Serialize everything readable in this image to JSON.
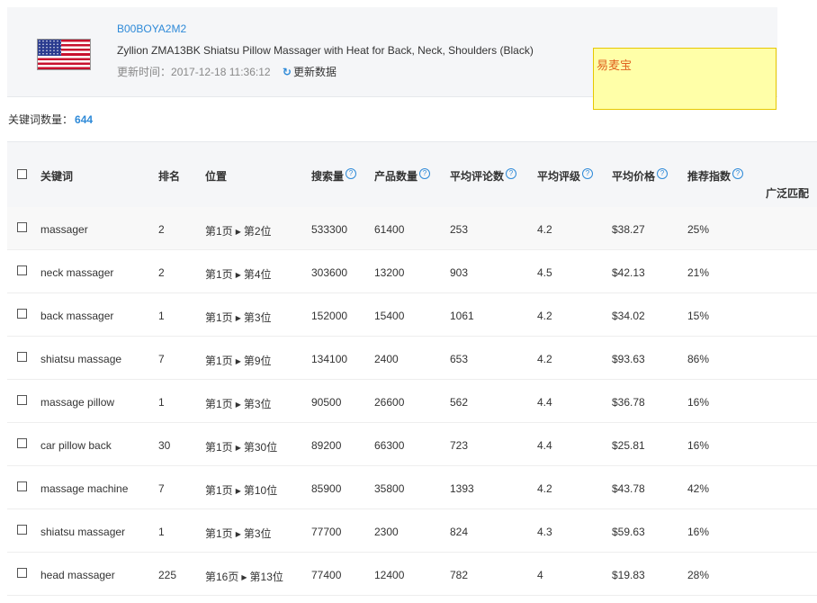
{
  "product": {
    "asin": "B00BOYA2M2",
    "title": "Zyllion ZMA13BK Shiatsu Pillow Massager with Heat for Back, Neck, Shoulders (Black)",
    "update_label": "更新时间：",
    "update_time": "2017-12-18 11:36:12",
    "refresh_label": "更新数据",
    "flag": "us-flag-icon"
  },
  "note": {
    "text": "易麦宝"
  },
  "summary": {
    "label": "关键词数量：",
    "count": "644"
  },
  "table": {
    "headers": {
      "keyword": "关键词",
      "rank": "排名",
      "position": "位置",
      "search_volume": "搜索量",
      "product_count": "产品数量",
      "avg_reviews": "平均评论数",
      "avg_rating": "平均评级",
      "avg_price": "平均价格",
      "recommend": "推荐指数",
      "broad_match": "广泛匹配"
    },
    "rows": [
      {
        "keyword": "massager",
        "rank": "2",
        "page": "第1页",
        "pos": "第2位",
        "search": "533300",
        "products": "61400",
        "reviews": "253",
        "rating": "4.2",
        "price": "$38.27",
        "recommend": "25%"
      },
      {
        "keyword": "neck massager",
        "rank": "2",
        "page": "第1页",
        "pos": "第4位",
        "search": "303600",
        "products": "13200",
        "reviews": "903",
        "rating": "4.5",
        "price": "$42.13",
        "recommend": "21%"
      },
      {
        "keyword": "back massager",
        "rank": "1",
        "page": "第1页",
        "pos": "第3位",
        "search": "152000",
        "products": "15400",
        "reviews": "1061",
        "rating": "4.2",
        "price": "$34.02",
        "recommend": "15%"
      },
      {
        "keyword": "shiatsu massage",
        "rank": "7",
        "page": "第1页",
        "pos": "第9位",
        "search": "134100",
        "products": "2400",
        "reviews": "653",
        "rating": "4.2",
        "price": "$93.63",
        "recommend": "86%"
      },
      {
        "keyword": "massage pillow",
        "rank": "1",
        "page": "第1页",
        "pos": "第3位",
        "search": "90500",
        "products": "26600",
        "reviews": "562",
        "rating": "4.4",
        "price": "$36.78",
        "recommend": "16%"
      },
      {
        "keyword": "car pillow back",
        "rank": "30",
        "page": "第1页",
        "pos": "第30位",
        "search": "89200",
        "products": "66300",
        "reviews": "723",
        "rating": "4.4",
        "price": "$25.81",
        "recommend": "16%"
      },
      {
        "keyword": "massage machine",
        "rank": "7",
        "page": "第1页",
        "pos": "第10位",
        "search": "85900",
        "products": "35800",
        "reviews": "1393",
        "rating": "4.2",
        "price": "$43.78",
        "recommend": "42%"
      },
      {
        "keyword": "shiatsu massager",
        "rank": "1",
        "page": "第1页",
        "pos": "第3位",
        "search": "77700",
        "products": "2300",
        "reviews": "824",
        "rating": "4.3",
        "price": "$59.63",
        "recommend": "16%"
      },
      {
        "keyword": "head massager",
        "rank": "225",
        "page": "第16页",
        "pos": "第13位",
        "search": "77400",
        "products": "12400",
        "reviews": "782",
        "rating": "4",
        "price": "$19.83",
        "recommend": "28%"
      }
    ]
  }
}
